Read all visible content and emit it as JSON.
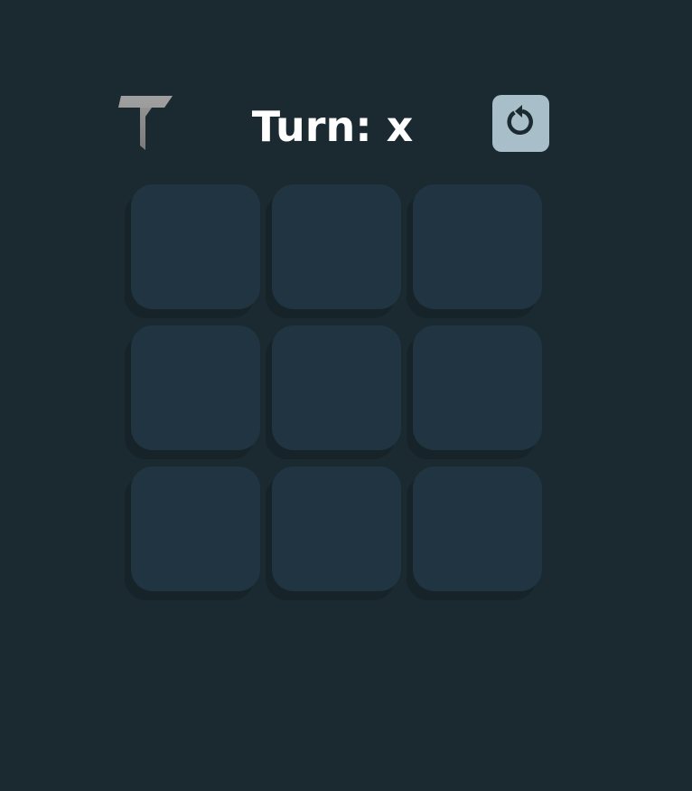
{
  "header": {
    "turn_text": "Turn: x",
    "logo_icon": "t-logo-icon",
    "reset_icon": "refresh-icon"
  },
  "board": {
    "cells": [
      "",
      "",
      "",
      "",
      "",
      "",
      "",
      "",
      ""
    ]
  },
  "colors": {
    "background": "#1b2931",
    "cell": "#203541",
    "cell_shadow": "#162329",
    "reset_button": "#a8bec8",
    "reset_icon": "#1b2931",
    "text": "#ffffff"
  }
}
